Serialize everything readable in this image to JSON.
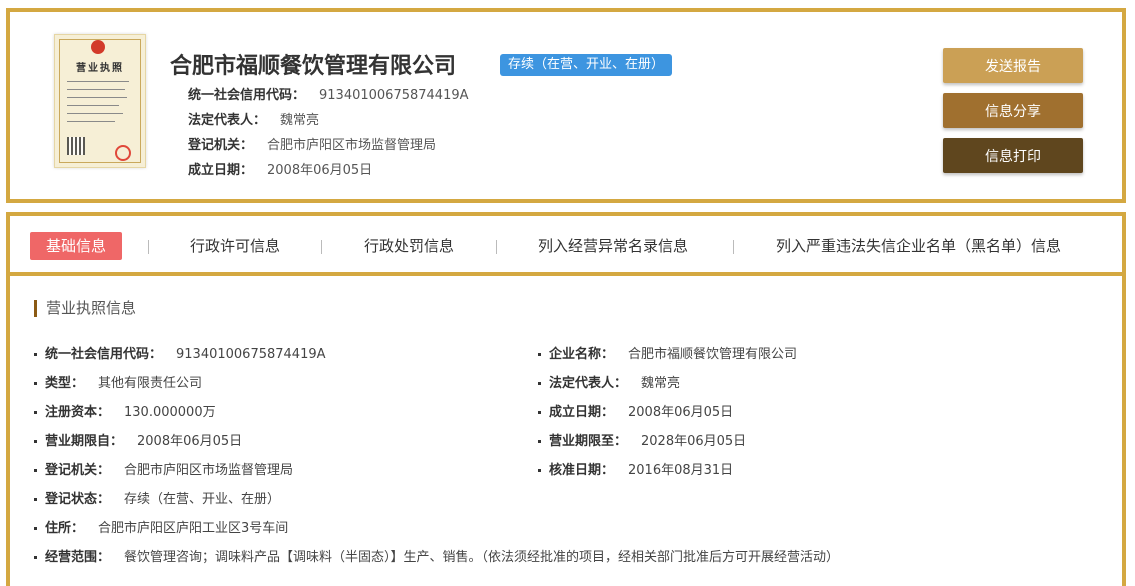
{
  "header": {
    "company_name": "合肥市福顺餐饮管理有限公司",
    "status": "存续（在营、开业、在册）",
    "license_thumb_title": "营业执照",
    "credit_code_label": "统一社会信用代码：",
    "credit_code": "91340100675874419A",
    "legal_rep_label": "法定代表人：",
    "legal_rep": "魏常亮",
    "authority_label": "登记机关：",
    "authority": "合肥市庐阳区市场监督管理局",
    "founded_label": "成立日期：",
    "founded": "2008年06月05日"
  },
  "actions": {
    "send_report": "发送报告",
    "share": "信息分享",
    "print": "信息打印"
  },
  "tabs": [
    {
      "label": "基础信息",
      "active": true
    },
    {
      "label": "行政许可信息",
      "active": false
    },
    {
      "label": "行政处罚信息",
      "active": false
    },
    {
      "label": "列入经营异常名录信息",
      "active": false
    },
    {
      "label": "列入严重违法失信企业名单（黑名单）信息",
      "active": false
    }
  ],
  "section_title": "营业执照信息",
  "fields": {
    "credit_code": {
      "label": "统一社会信用代码：",
      "value": "91340100675874419A"
    },
    "company_name": {
      "label": "企业名称：",
      "value": "合肥市福顺餐饮管理有限公司"
    },
    "type": {
      "label": "类型：",
      "value": "其他有限责任公司"
    },
    "legal_rep": {
      "label": "法定代表人：",
      "value": "魏常亮"
    },
    "capital": {
      "label": "注册资本：",
      "value": "130.000000万"
    },
    "founded": {
      "label": "成立日期：",
      "value": "2008年06月05日"
    },
    "term_from": {
      "label": "营业期限自：",
      "value": "2008年06月05日"
    },
    "term_to": {
      "label": "营业期限至：",
      "value": "2028年06月05日"
    },
    "authority": {
      "label": "登记机关：",
      "value": "合肥市庐阳区市场监督管理局"
    },
    "approved": {
      "label": "核准日期：",
      "value": "2016年08月31日"
    },
    "reg_status": {
      "label": "登记状态：",
      "value": "存续（在营、开业、在册）"
    },
    "address": {
      "label": "住所：",
      "value": "合肥市庐阳区庐阳工业区3号车间"
    },
    "scope": {
      "label": "经营范围：",
      "value": "餐饮管理咨询；调味料产品【调味料（半固态）】生产、销售。（依法须经批准的项目，经相关部门批准后方可开展经营活动）"
    }
  },
  "colors": {
    "border_gold": "#d4a841",
    "status_blue": "#3d95e0",
    "tab_active": "#ef6767",
    "btn_send": "#cba055",
    "btn_share": "#a0702f",
    "btn_print": "#5f461e"
  }
}
